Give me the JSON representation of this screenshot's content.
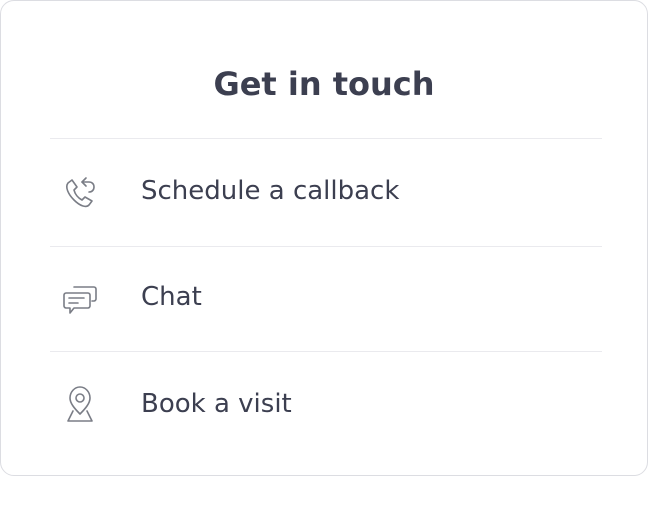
{
  "card": {
    "title": "Get in touch",
    "options": [
      {
        "label": "Schedule a callback",
        "icon": "phone-callback-icon"
      },
      {
        "label": "Chat",
        "icon": "chat-bubbles-icon"
      },
      {
        "label": "Book a visit",
        "icon": "location-pin-icon"
      }
    ]
  },
  "colors": {
    "text": "#3c3f50",
    "icon_stroke": "#7a7d86",
    "divider": "#eaeaee",
    "card_border": "#dcdde2"
  }
}
